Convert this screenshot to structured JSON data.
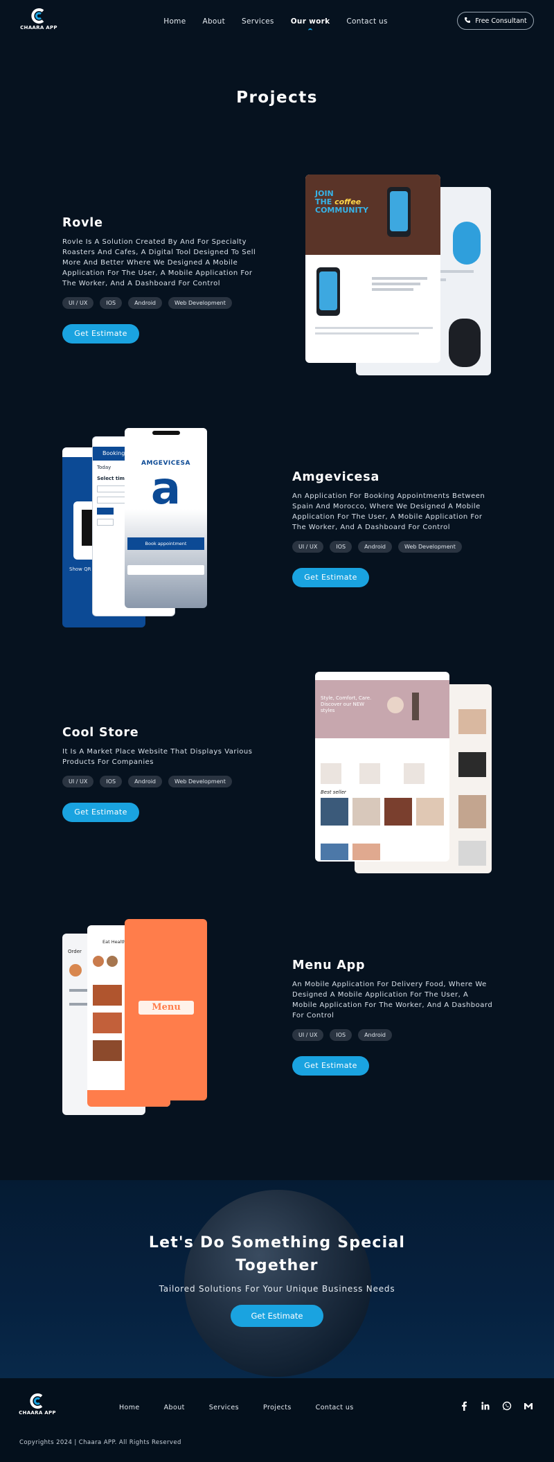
{
  "header": {
    "logo_text": "CHAARA APP",
    "nav": [
      "Home",
      "About",
      "Services",
      "Our work",
      "Contact us"
    ],
    "active_nav": "Our work",
    "cta_label": "Free Consultant"
  },
  "section_title": "Projects",
  "projects": [
    {
      "name": "Rovle",
      "description": "Rovle Is A Solution Created By And For Specialty Roasters And Cafes, A Digital Tool Designed To Sell More And Better Where We Designed A Mobile Application For The User, A Mobile Application For The Worker, And A Dashboard For Control",
      "tags": [
        "UI / UX",
        "IOS",
        "Android",
        "Web Development"
      ],
      "button": "Get Estimate",
      "mock_text": [
        "JOIN",
        "THE",
        "coffee",
        "COMMUNITY"
      ]
    },
    {
      "name": "Amgevicesa",
      "description": "An Application For Booking Appointments Between Spain And Morocco, Where We Designed A Mobile Application For The User, A Mobile Application For The Worker, And A Dashboard For Control",
      "tags": [
        "UI / UX",
        "IOS",
        "Android",
        "Web Development"
      ],
      "button": "Get Estimate",
      "mock_text": [
        "AMGEVICESA",
        "Book appointment",
        "Booking",
        "Today",
        "Select time",
        "Show QR"
      ]
    },
    {
      "name": "Cool Store",
      "description": "It Is A Market Place Website That Displays Various Products For Companies",
      "tags": [
        "UI / UX",
        "IOS",
        "Android",
        "Web Development"
      ],
      "button": "Get Estimate",
      "mock_text": [
        "Style, Comfort, Care. Discover our NEW styles",
        "Best seller"
      ]
    },
    {
      "name": "Menu App",
      "description": "An Mobile Application For  Delivery Food, Where We Designed A Mobile Application For The User, A Mobile Application For The Worker, And A Dashboard For Control",
      "tags": [
        "UI / UX",
        "IOS",
        "Android"
      ],
      "button": "Get Estimate",
      "mock_text": [
        "Menu",
        "Eat Healthy",
        "Order"
      ]
    }
  ],
  "cta": {
    "title_line1": "Let's Do Something Special",
    "title_line2": "Together",
    "subtitle": "Tailored Solutions For Your Unique Business Needs",
    "button": "Get Estimate"
  },
  "footer": {
    "logo_text": "CHAARA APP",
    "nav": [
      "Home",
      "About",
      "Services",
      "Projects",
      "Contact us"
    ],
    "social": [
      "facebook-icon",
      "linkedin-icon",
      "whatsapp-icon",
      "gmail-icon"
    ],
    "copyright": "Copyrights 2024 | Chaara APP. All Rights Reserved"
  },
  "colors": {
    "background": "#06121f",
    "accent": "#1aa3e0",
    "tag": "#2a3441"
  }
}
